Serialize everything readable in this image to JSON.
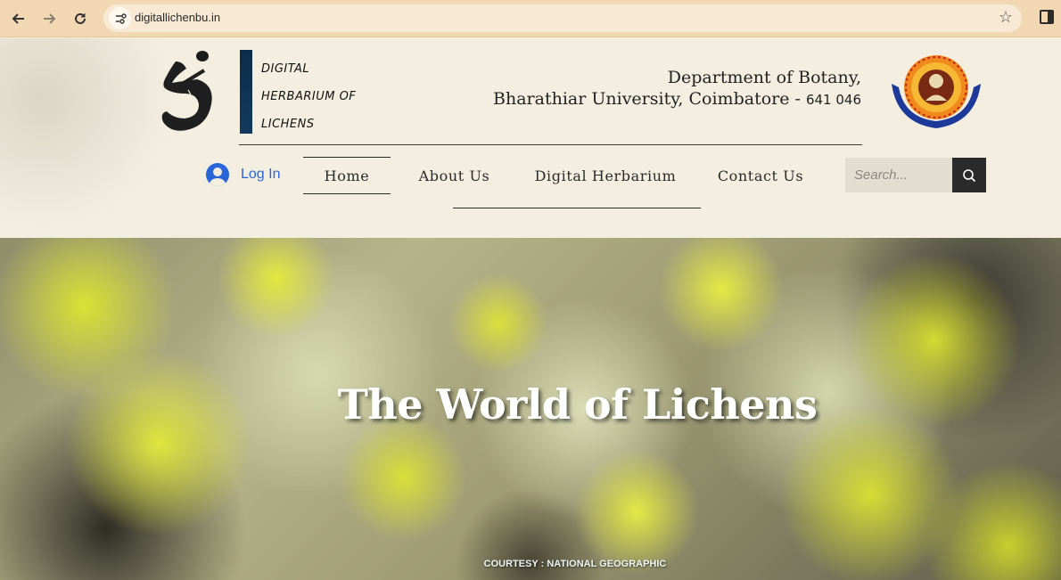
{
  "browser": {
    "url": "digitallichenbu.in"
  },
  "logo": {
    "line1": "DIGITAL",
    "line2": "HERBARIUM OF",
    "line3": "LICHENS"
  },
  "department": {
    "line1": "Department of Botany,",
    "line2": "Bharathiar University, Coimbatore - ",
    "pincode": "641 046"
  },
  "login": {
    "label": "Log In"
  },
  "nav": {
    "items": [
      {
        "label": "Home",
        "active": true
      },
      {
        "label": "About Us",
        "active": false
      },
      {
        "label": "Digital Herbarium",
        "active": false
      },
      {
        "label": "Contact Us",
        "active": false
      }
    ]
  },
  "search": {
    "placeholder": "Search..."
  },
  "hero": {
    "title": "The World of Lichens",
    "credit": "COURTESY : NATIONAL GEOGRAPHIC"
  },
  "colors": {
    "chrome": "#f2d7b3",
    "page_bg": "#f3eee0",
    "login_blue": "#2a65d9",
    "logo_bar": "#0d2c4a",
    "search_button": "#2b2b2b",
    "lichen_yellow": "#d9e233"
  }
}
